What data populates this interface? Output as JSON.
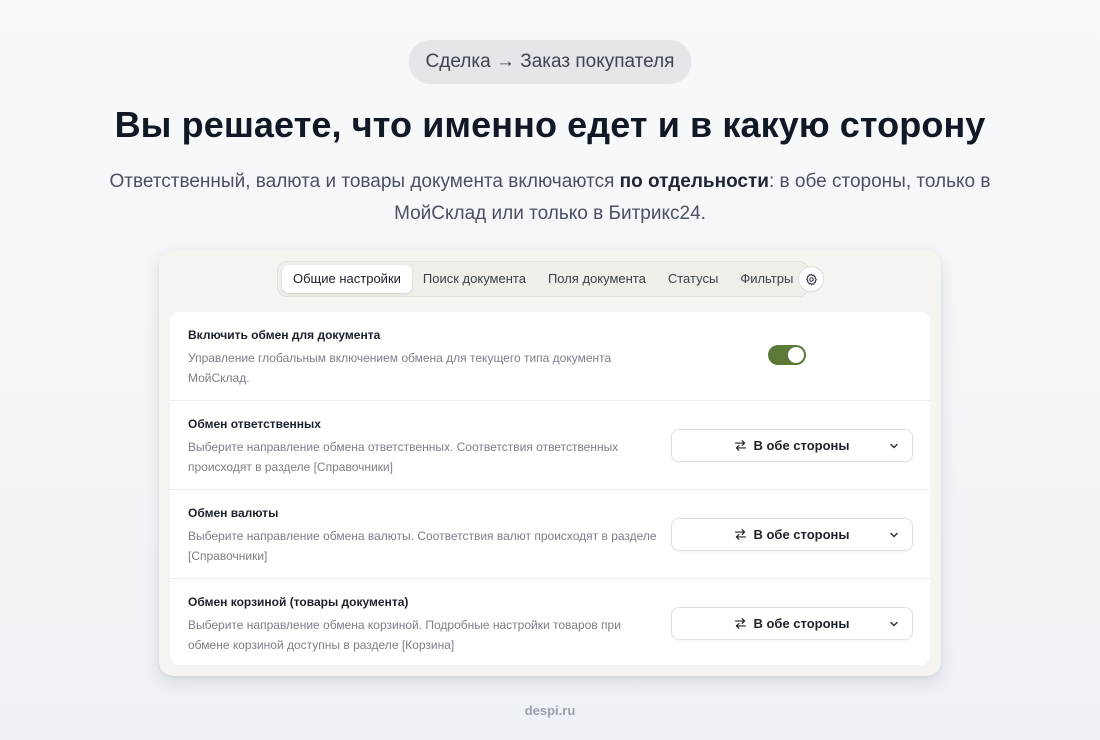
{
  "badge": "Сделка → Заказ покупателя",
  "headline": "Вы решаете, что именно едет и в какую сторону",
  "subtitle": {
    "before": "Ответственный, валюта и товары документа включаются ",
    "bold": "по отдельности",
    "after": ": в обе стороны, только в МойСклад или только в Битрикс24."
  },
  "tabs": [
    {
      "label": "Общие настройки",
      "active": true
    },
    {
      "label": "Поиск документа",
      "active": false
    },
    {
      "label": "Поля документа",
      "active": false
    },
    {
      "label": "Статусы",
      "active": false
    },
    {
      "label": "Фильтры",
      "active": false
    }
  ],
  "settings_icon": "gear-icon",
  "rows": [
    {
      "title": "Включить обмен для документа",
      "description": "Управление глобальным включением обмена для текущего типа документа МойСклад.",
      "control": "toggle",
      "enabled": true
    },
    {
      "title": "Обмен ответственных",
      "description": "Выберите направление обмена ответственных. Соответствия ответственных происходят в разделе [Справочники]",
      "control": "select",
      "value": "В обе стороны"
    },
    {
      "title": "Обмен валюты",
      "description": "Выберите направление обмена валюты. Соответствия валют происходят в разделе [Справочники]",
      "control": "select",
      "value": "В обе стороны"
    },
    {
      "title": "Обмен корзиной (товары документа)",
      "description": "Выберите направление обмена корзиной. Подробные настройки товаров при обмене корзиной доступны в разделе [Корзина]",
      "control": "select",
      "value": "В обе стороны"
    }
  ],
  "colors": {
    "toggle_on": "#5b7a37",
    "badge_bg": "#e4e6ea"
  },
  "footer": "despi.ru"
}
